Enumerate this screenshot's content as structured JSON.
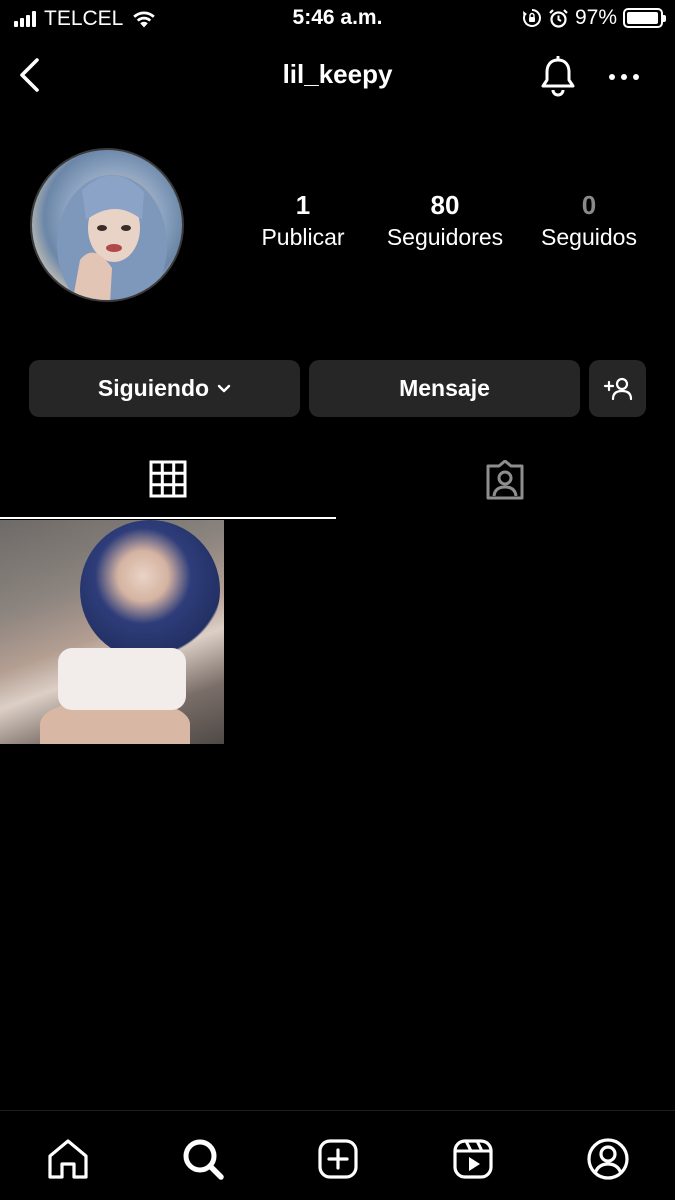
{
  "status_bar": {
    "carrier": "TELCEL",
    "time": "5:46 a.m.",
    "battery_percent_label": "97%",
    "battery_level": 0.97,
    "icons": [
      "signal-icon",
      "wifi-icon",
      "orientation-lock-icon",
      "alarm-icon",
      "battery-icon"
    ]
  },
  "header": {
    "username": "lil_keepy",
    "icons": [
      "back-chevron-icon",
      "bell-icon",
      "more-dots-icon"
    ]
  },
  "profile": {
    "stats": [
      {
        "value": "1",
        "label": "Publicar"
      },
      {
        "value": "80",
        "label": "Seguidores"
      },
      {
        "value": "0",
        "label": "Seguidos"
      }
    ]
  },
  "actions": {
    "following_label": "Siguiendo",
    "message_label": "Mensaje",
    "icons": [
      "chevron-down-icon",
      "add-person-icon"
    ]
  },
  "tabs": [
    {
      "icon": "grid-icon",
      "active": true
    },
    {
      "icon": "tagged-icon",
      "active": false
    }
  ],
  "posts_count": 1,
  "bottom_nav": {
    "items": [
      "home-icon",
      "search-icon",
      "create-icon",
      "reels-icon",
      "profile-icon"
    ],
    "active": "search-icon"
  },
  "colors": {
    "background": "#000000",
    "button_bg": "#262626",
    "muted_text": "#8a8a8a",
    "text": "#ffffff"
  }
}
